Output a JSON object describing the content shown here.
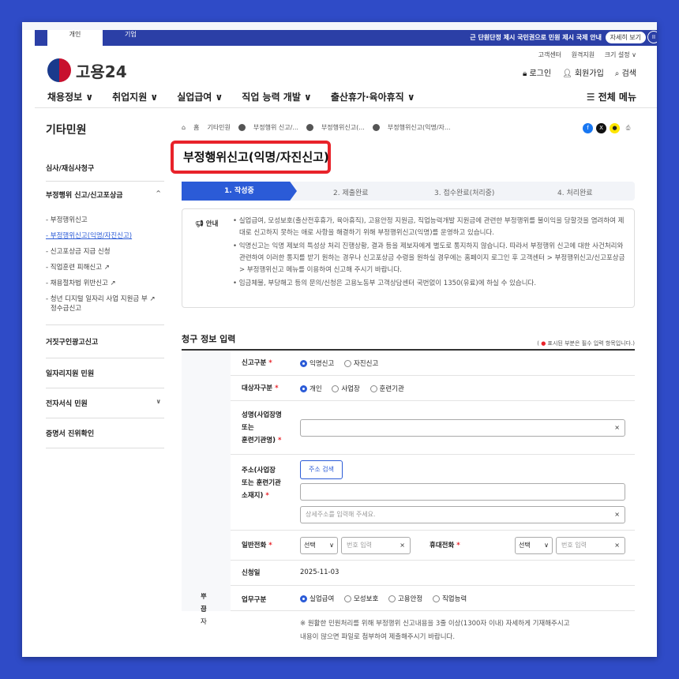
{
  "topbar": {
    "tab_personal": "개인",
    "tab_company": "기업",
    "notice": "근 단원단정 제시 국민권으로 민원 제시 국제 안내",
    "more": "자세히 보기",
    "pause": "II"
  },
  "util": {
    "items": [
      "고객센터",
      "원격지원",
      "크기 설정 ∨"
    ]
  },
  "logo": {
    "text": "고용24"
  },
  "account": {
    "login": "로그인",
    "join": "회원가입",
    "search": "검색"
  },
  "gnb": {
    "items": [
      "채용정보 ∨",
      "취업지원 ∨",
      "실업급여 ∨",
      "직업 능력 개발 ∨",
      "출산휴가·육아휴직 ∨"
    ],
    "all_menu": "☰ 전체 메뉴"
  },
  "side": {
    "title": "기타민원",
    "menu1": "심사/재심사청구",
    "menu2": "부정행위 신고/신고포상금",
    "subs": [
      "- 부정행위신고",
      "- 부정행위신고(익명/자진신고)",
      "- 신고포상금 지급 신청",
      "- 직업훈련 피해신고 ↗",
      "- 채용절차법 위반신고 ↗",
      "- 청년 디지털 일자리 사업 지원금 부 ↗",
      "정수급신고"
    ],
    "menu3": "거짓구인광고신고",
    "menu4": "일자리지원 민원",
    "menu5": "전자서식 민원",
    "menu6": "증명서 진위확인"
  },
  "breadcrumb": {
    "home": "홈",
    "items": [
      "기타민원",
      "부정행위 신고/...",
      "부정행위신고(...",
      "부정행위신고(익명/자..."
    ]
  },
  "page_title": "부정행위신고(익명/자진신고)",
  "steps": [
    "1. 작성중",
    "2. 제출완료",
    "3. 접수완료(처리중)",
    "4. 처리완료"
  ],
  "guide": {
    "label": "안내",
    "p1": "• 실업급여, 모성보호(출산전후휴가, 육아휴직), 고용안정 지원금, 직업능력개발 지원금에 관련한 부정행위를 불이익을 당할것을 염려하여 제대로 신고하지 못하는 애로 사항을 해결하기 위해 부정행위신고(익명)를 운영하고 있습니다.",
    "p2": "• 익명신고는 익명 제보의 특성상 처리 진행상황, 결과 등을 제보자에게 별도로 통지하지 않습니다. 따라서 부정행위 신고에 대한 사건처리와 관련하여 이러한 통지를 받기 원하는 경우나 신고포상금 수령을 원하실 경우에는 홈페이지 로그인 후 고객센터 > 부정행위신고/신고포상금 > 부정행위신고 메뉴를 이용하여 신고해 주시기 바랍니다.",
    "p3": "• 임금체불, 부당해고 등의 문의/신청은 고용노동부 고객상담센터 국번없이 1350(유료)에 하실 수 있습니다."
  },
  "form": {
    "section_title": "청구 정보 입력",
    "required_note_pre": "( ",
    "required_note_star": "●",
    "required_note": " 표시된 부분은 필수 입력 항목입니다.)",
    "group_label_1": "부정",
    "group_label_2": "수급자",
    "report_type": {
      "label": "신고구분",
      "options": [
        "익명신고",
        "자진신고"
      ]
    },
    "target_type": {
      "label": "대상자구분",
      "options": [
        "개인",
        "사업장",
        "훈련기관"
      ]
    },
    "name": {
      "label_1": "성명(사업장명",
      "label_2": "또는",
      "label_3": "훈련기관명)"
    },
    "address": {
      "label_1": "주소(사업장",
      "label_2": "또는 훈련기관",
      "label_3": "소재지)",
      "search_button": "주소 검색",
      "detail_placeholder": "상세주소를 입력해 주세요."
    },
    "phone": {
      "label": "일반전화",
      "select": "선택",
      "placeholder": "번호 입력"
    },
    "mobile": {
      "label": "휴대전화",
      "select": "선택",
      "placeholder": "번호 입력"
    },
    "date": {
      "label": "신청일",
      "value": "2025-11-03"
    },
    "business": {
      "label": "업무구분",
      "options": [
        "실업급여",
        "모성보호",
        "고용안정",
        "직업능력"
      ]
    },
    "note_1": "※ 원활한 민원처리를 위해 부정행위 신고내용을 3줄 이상(1300자 이내) 자세하게 기재해주시고",
    "note_2": "내용이 많으면 파일로 첨부하여 제출해주시기 바랍니다."
  },
  "colors": {
    "accent": "#2b5bd7",
    "highlight": "#e8232a",
    "topbar": "#2b3fa6"
  }
}
